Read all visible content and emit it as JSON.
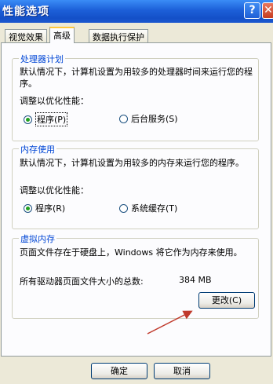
{
  "window": {
    "title": "性能选项",
    "help_label": "?",
    "close_label": "✕"
  },
  "tabs": [
    {
      "label": "视觉效果",
      "active": false
    },
    {
      "label": "高级",
      "active": true
    },
    {
      "label": "数据执行保护",
      "active": false
    }
  ],
  "processor": {
    "title": "处理器计划",
    "description": "默认情况下，计算机设置为用较多的处理器时间来运行您的程序。",
    "adjust_label": "调整以优化性能：",
    "options": [
      {
        "label": "程序(P)",
        "selected": true
      },
      {
        "label": "后台服务(S)",
        "selected": false
      }
    ]
  },
  "memory": {
    "title": "内存使用",
    "description": "默认情况下，计算机设置为用较多的内存来运行您的程序。",
    "adjust_label": "调整以优化性能：",
    "options": [
      {
        "label": "程序(R)",
        "selected": true
      },
      {
        "label": "系统缓存(T)",
        "selected": false
      }
    ]
  },
  "virtual_memory": {
    "title": "虚拟内存",
    "description": "页面文件存在于硬盘上，Windows 将它作为内存来使用。",
    "total_label": "所有驱动器页面文件大小的总数:",
    "total_value": "384 MB",
    "change_button": "更改(C)"
  },
  "footer": {
    "ok_label": "确定",
    "cancel_label": "取消"
  },
  "colors": {
    "titlebar": "#1c5fd8",
    "group_title": "#0046d5",
    "arrow": "#c0392b"
  }
}
